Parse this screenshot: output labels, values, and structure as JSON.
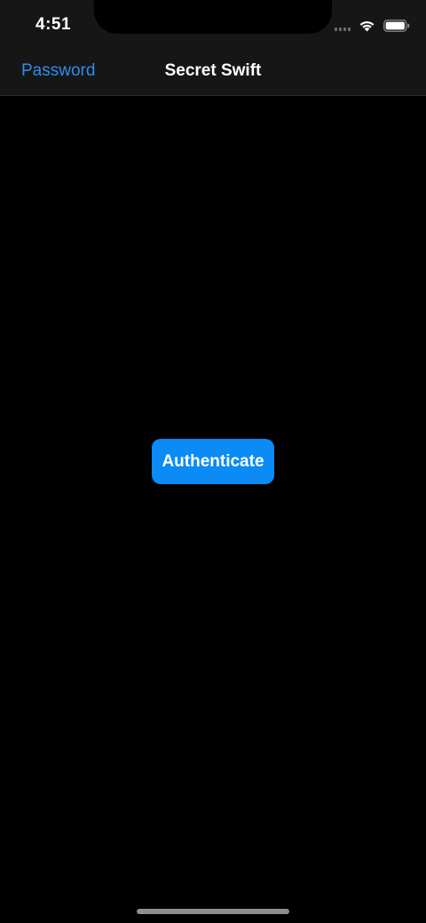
{
  "status_bar": {
    "time": "4:51",
    "icons": [
      "signal-icon",
      "wifi-icon",
      "battery-icon"
    ]
  },
  "nav_bar": {
    "back_label": "Password",
    "title": "Secret Swift"
  },
  "main": {
    "authenticate_label": "Authenticate"
  },
  "colors": {
    "accent": "#2f8cf0",
    "button_background": "#0a8bf5",
    "background": "#000000",
    "bar_background": "#161616"
  }
}
